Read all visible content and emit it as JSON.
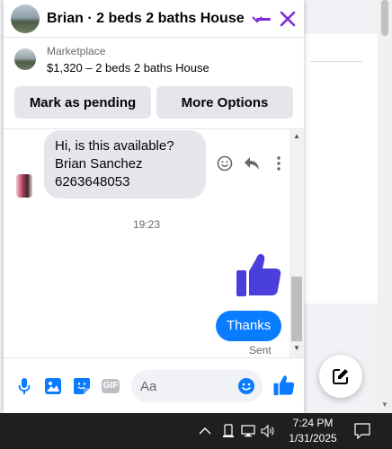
{
  "header": {
    "title": "Brian · 2 beds 2 baths House"
  },
  "marketplace": {
    "label": "Marketplace",
    "listing": "$1,320 – 2 beds 2 baths House"
  },
  "actions": {
    "mark_pending": "Mark as pending",
    "more_options": "More Options"
  },
  "messages": {
    "incoming_lines": [
      "Hi, is this available?",
      "Brian Sanchez",
      "6263648053"
    ],
    "timestamp": "19:23",
    "outgoing": "Thanks",
    "status": "Sent"
  },
  "composer": {
    "placeholder": "Aa",
    "gif_label": "GIF"
  },
  "taskbar": {
    "time": "7:24 PM",
    "date": "1/31/2025"
  },
  "colors": {
    "accent_purple": "#7b2bdc",
    "messenger_blue": "#0a7cff",
    "like_blue": "#4b3fdc"
  }
}
